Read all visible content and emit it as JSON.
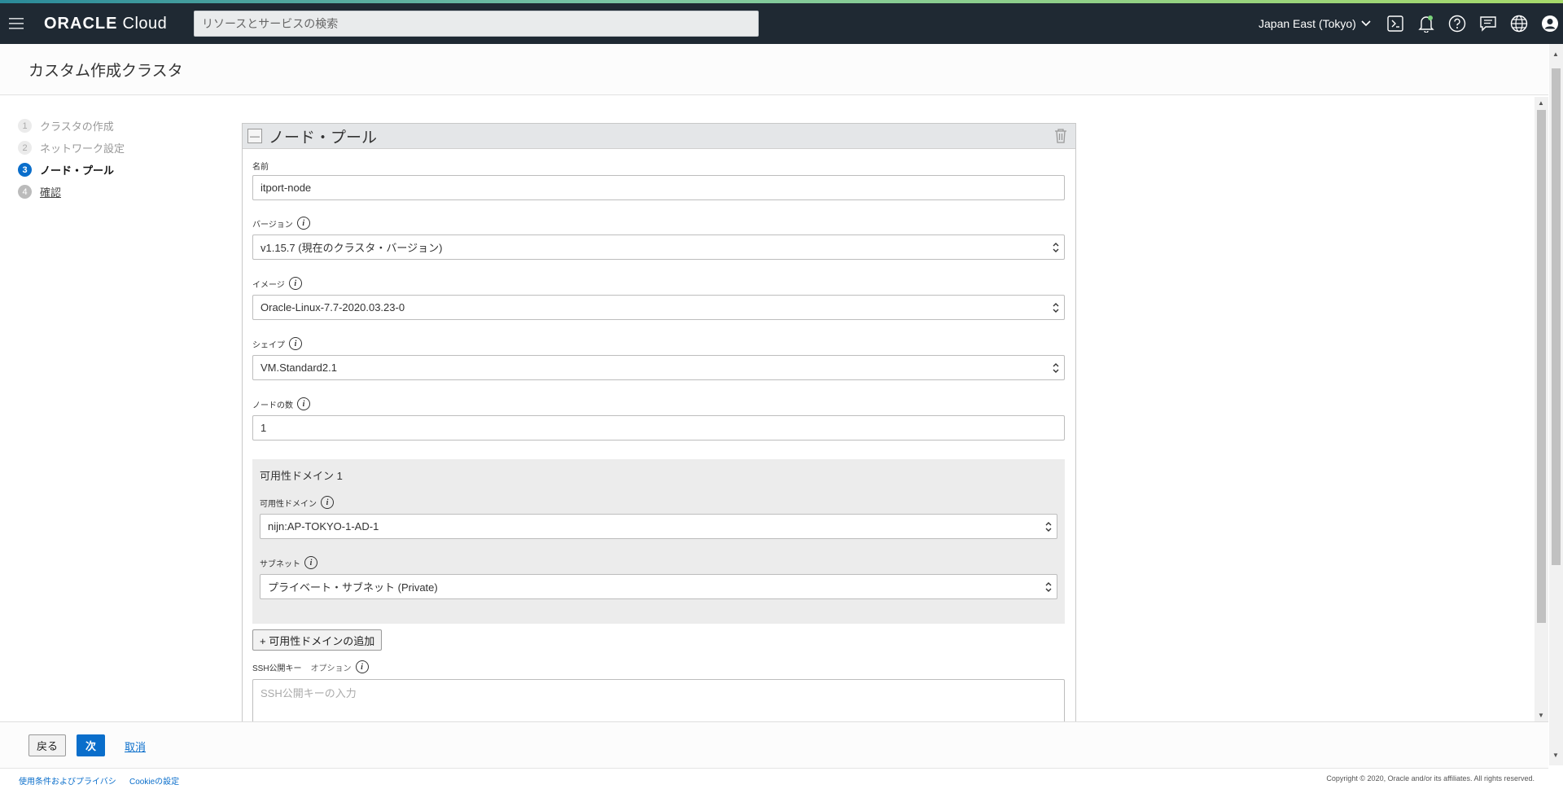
{
  "topbar": {
    "logo_bold": "ORACLE",
    "logo_rest": " Cloud",
    "search_placeholder": "リソースとサービスの検索",
    "region": "Japan East (Tokyo)"
  },
  "page": {
    "title": "カスタム作成クラスタ"
  },
  "steps": [
    {
      "num": "1",
      "label": "クラスタの作成"
    },
    {
      "num": "2",
      "label": "ネットワーク設定"
    },
    {
      "num": "3",
      "label": "ノード・プール"
    },
    {
      "num": "4",
      "label": "確認"
    }
  ],
  "panel": {
    "title": "ノード・プール",
    "collapse_glyph": "—"
  },
  "form": {
    "name_label": "名前",
    "name_value": "itport-node",
    "version_label": "バージョン",
    "version_value": "v1.15.7 (現在のクラスタ・バージョン)",
    "image_label": "イメージ",
    "image_value": "Oracle-Linux-7.7-2020.03.23-0",
    "shape_label": "シェイプ",
    "shape_value": "VM.Standard2.1",
    "nodes_label": "ノードの数",
    "nodes_value": "1",
    "ad_section_title": "可用性ドメイン 1",
    "ad_label": "可用性ドメイン",
    "ad_value": "nijn:AP-TOKYO-1-AD-1",
    "subnet_label": "サブネット",
    "subnet_value": "プライベート・サブネット (Private)",
    "add_ad_label": "+ 可用性ドメインの追加",
    "ssh_label": "SSH公開キー",
    "ssh_optional": "オプション",
    "ssh_placeholder": "SSH公開キーの入力"
  },
  "actions": {
    "back": "戻る",
    "next": "次",
    "cancel": "取消"
  },
  "footer": {
    "terms": "使用条件およびプライバシ",
    "cookie": "Cookieの設定",
    "copyright": "Copyright © 2020, Oracle and/or its affiliates. All rights reserved."
  },
  "colors": {
    "topbar": "#1f2933",
    "accent": "#0a6ecb"
  }
}
